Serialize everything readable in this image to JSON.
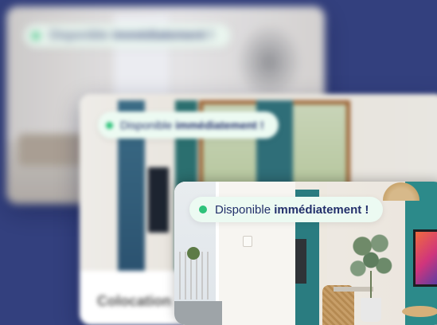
{
  "colors": {
    "background": "#33407e",
    "badge_bg": "#ecfaf2",
    "badge_text": "#23306b",
    "status_dot": "#2ec27a"
  },
  "cards": [
    {
      "badge": {
        "prefix": "Disponible",
        "emphasis": "immédiatement !"
      }
    },
    {
      "badge": {
        "prefix": "Disponible",
        "emphasis": "immédiatement !"
      },
      "title": "Colocation"
    },
    {
      "badge": {
        "prefix": "Disponible",
        "emphasis": "immédiatement !"
      }
    }
  ]
}
